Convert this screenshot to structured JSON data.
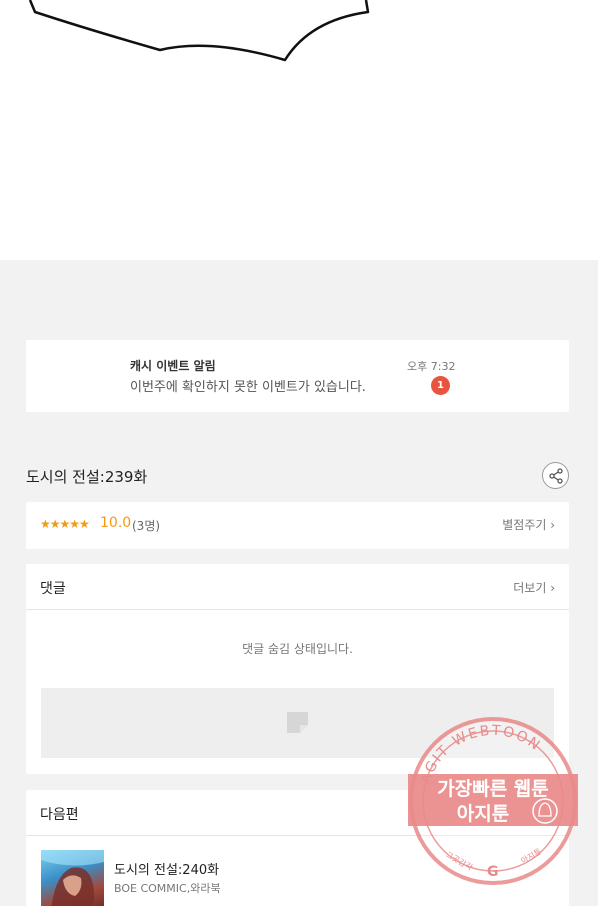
{
  "notification": {
    "title": "캐시 이벤트 알림",
    "body": "이번주에 확인하지 못한 이벤트가 있습니다.",
    "time": "오후 7:32",
    "badge": "1"
  },
  "episode": {
    "title": "도시의 전설:239화"
  },
  "rating": {
    "stars": "★★★★★",
    "score": "10.0",
    "count": "(3명)",
    "link_label": "별점주기 ›"
  },
  "comments": {
    "header": "댓글",
    "more_label": "더보기 ›",
    "hidden_message": "댓글 숨김 상태입니다."
  },
  "next_episode": {
    "header": "다음편",
    "title": "도시의 전설:240화",
    "author": "BOE COMMIC,와라북"
  },
  "watermark": {
    "arc_text": "AGIT WEBTOON",
    "line1": "가장빠른 웹툰",
    "line2": "아지툰",
    "small_left": "그곳감각",
    "small_right": "아지툰"
  },
  "colors": {
    "accent_orange": "#f39a13",
    "badge_red": "#e8553f",
    "stamp_red": "#e98a8a"
  }
}
